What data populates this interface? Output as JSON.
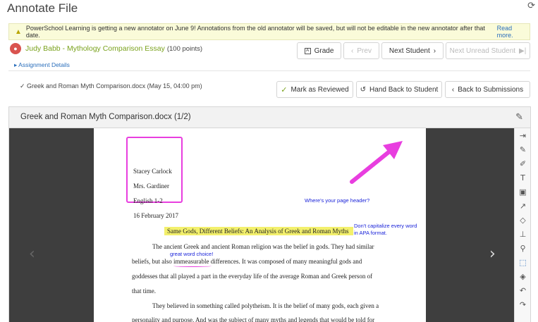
{
  "page": {
    "title": "Annotate File"
  },
  "banner": {
    "message": "PowerSchool Learning is getting a new annotator on June 9! Annotations from the old annotator will be saved, but will not be editable in the new annotator after that date.",
    "link": "Read more."
  },
  "student": {
    "name": "Judy Babb - Mythology Comparison Essay",
    "points": "(100 points)",
    "assignment_details": "Assignment Details"
  },
  "nav": {
    "grade": "Grade",
    "prev": "Prev",
    "next": "Next Student",
    "next_unread": "Next Unread Student"
  },
  "submission": {
    "file_info": "Greek and Roman Myth Comparison.docx (May 15, 04:00 pm)",
    "mark_reviewed": "Mark as Reviewed",
    "hand_back": "Hand Back to Student",
    "back": "Back to Submissions"
  },
  "viewer": {
    "title": "Greek and Roman Myth Comparison.docx (1/2)"
  },
  "document": {
    "header_lines": [
      "Stacey Carlock",
      "Mrs. Gardiner",
      "English 1-2",
      "16 February 2017"
    ],
    "essay_title": "Same Gods, Different Beliefs: An Analysis of Greek and Roman Myths",
    "para1": [
      "The ancient Greek and ancient Roman religion was the belief in gods. They had similar",
      "beliefs, but also immeasurable differences. It was composed of many meaningful gods and",
      "goddesses that all played a part in the everyday life of the average Roman and Greek person of",
      "that time."
    ],
    "para2": [
      "They believed in something called polytheism. It is the belief of many gods, each given a",
      "personality and purpose. And was the subject of many myths and legends that would be told for"
    ]
  },
  "annotations": {
    "page_header": "Where's your page header?",
    "capitalize": [
      "Don't capitalize every word",
      "in APA format."
    ],
    "word_choice": "great word choice!",
    "highlight_color": "#f3f06c",
    "ink_color": "#e83edf",
    "text_color": "#1a23d9"
  }
}
